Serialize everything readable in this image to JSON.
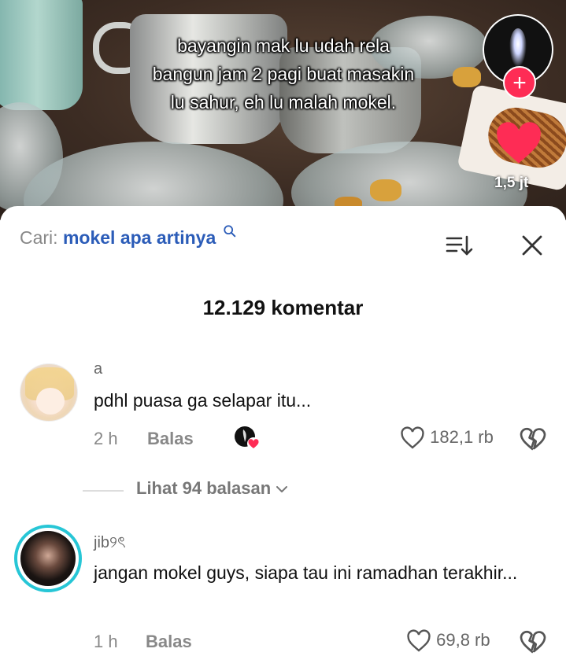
{
  "video": {
    "caption_lines": [
      "bayangin mak lu udah rela",
      "bangun jam 2 pagi buat masakin",
      "lu sahur, eh lu malah mokel."
    ],
    "follow_symbol": "+",
    "like_count": "1,5 jt"
  },
  "sheet": {
    "search_prefix": "Cari:",
    "search_term": "mokel apa artinya",
    "comment_count": "12.129 komentar",
    "view_replies": "Lihat 94 balasan"
  },
  "comments": [
    {
      "username": "a",
      "text": "pdhl puasa ga selapar itu...",
      "time": "2 h",
      "reply_label": "Balas",
      "likes": "182,1 rb"
    },
    {
      "username": "jib୨ৎ",
      "text": "jangan mokel guys, siapa tau ini ramadhan terakhir...",
      "time": "1 h",
      "reply_label": "Balas",
      "likes": "69,8 rb"
    }
  ],
  "colors": {
    "accent": "#fe2c55",
    "search_term": "#2b5cb8",
    "avatar_ring": "#27c6d6"
  }
}
